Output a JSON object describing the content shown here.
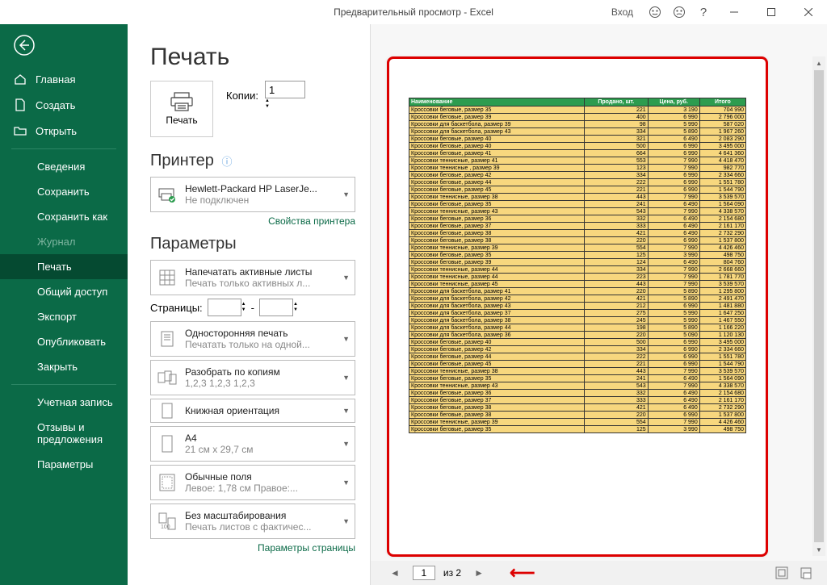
{
  "titlebar": {
    "title": "Предварительный просмотр  -  Excel",
    "login": "Вход"
  },
  "sidebar": {
    "home": "Главная",
    "new": "Создать",
    "open": "Открыть",
    "info": "Сведения",
    "save": "Сохранить",
    "saveas": "Сохранить как",
    "history": "Журнал",
    "print": "Печать",
    "share": "Общий доступ",
    "export": "Экспорт",
    "publish": "Опубликовать",
    "close": "Закрыть",
    "account": "Учетная запись",
    "feedback": "Отзывы и предложения",
    "options": "Параметры"
  },
  "print": {
    "heading": "Печать",
    "button": "Печать",
    "copies_label": "Копии:",
    "copies_value": "1",
    "printer_heading": "Принтер",
    "printer_name": "Hewlett-Packard HP LaserJe...",
    "printer_status": "Не подключен",
    "printer_props": "Свойства принтера",
    "params_heading": "Параметры",
    "active_sheets": "Напечатать активные листы",
    "active_sheets_sub": "Печать только активных л...",
    "pages_label": "Страницы:",
    "pages_sep": "-",
    "oneside": "Односторонняя печать",
    "oneside_sub": "Печатать только на одной...",
    "collate": "Разобрать по копиям",
    "collate_sub": "1,2,3    1,2,3    1,2,3",
    "orientation": "Книжная ориентация",
    "paper": "A4",
    "paper_sub": "21 см x 29,7 см",
    "margins": "Обычные поля",
    "margins_sub": "Левое: 1,78 см   Правое:...",
    "scaling": "Без масштабирования",
    "scaling_sub": "Печать листов с фактичес...",
    "page_setup": "Параметры страницы"
  },
  "status": {
    "page": "1",
    "of": "из 2"
  },
  "chart_data": {
    "type": "table",
    "headers": [
      "Наименование",
      "Продано, шт.",
      "Цена, руб.",
      "Итого"
    ],
    "rows": [
      [
        "Кроссовки беговые, размер 35",
        "221",
        "3 190",
        "704 990"
      ],
      [
        "Кроссовки беговые, размер 39",
        "400",
        "6 990",
        "2 796 000"
      ],
      [
        "Кроссовки для баскетбола, размер 39",
        "98",
        "5 990",
        "587 020"
      ],
      [
        "Кроссовки для баскетбола, размер 43",
        "334",
        "5 890",
        "1 967 260"
      ],
      [
        "Кроссовки беговые, размер 40",
        "321",
        "6 490",
        "2 083 290"
      ],
      [
        "Кроссовки беговые, размер 40",
        "500",
        "6 990",
        "3 495 000"
      ],
      [
        "Кроссовки беговые, размер 41",
        "664",
        "6 990",
        "4 641 360"
      ],
      [
        "Кроссовки теннисные, размер 41",
        "553",
        "7 990",
        "4 418 470"
      ],
      [
        "Кроссовки теннисные , размер 39",
        "123",
        "7 990",
        "982 770"
      ],
      [
        "Кроссовки беговые, размер 42",
        "334",
        "6 990",
        "2 334 660"
      ],
      [
        "Кроссовки беговые, размер 44",
        "222",
        "6 990",
        "1 551 780"
      ],
      [
        "Кроссовки беговые, размер 45",
        "221",
        "6 990",
        "1 544 790"
      ],
      [
        "Кроссовки теннисные, размер 38",
        "443",
        "7 990",
        "3 539 570"
      ],
      [
        "Кроссовки беговые, размер 35",
        "241",
        "6 490",
        "1 564 090"
      ],
      [
        "Кроссовки теннисные, размер 43",
        "543",
        "7 990",
        "4 338 570"
      ],
      [
        "Кроссовки беговые, размер 36",
        "332",
        "6 490",
        "2 154 680"
      ],
      [
        "Кроссовки беговые, размер 37",
        "333",
        "6 490",
        "2 161 170"
      ],
      [
        "Кроссовки беговые, размер 38",
        "421",
        "6 490",
        "2 732 290"
      ],
      [
        "Кроссовки беговые, размер 38",
        "220",
        "6 990",
        "1 537 800"
      ],
      [
        "Кроссовки теннисные, размер 39",
        "554",
        "7 990",
        "4 426 460"
      ],
      [
        "Кроссовки беговые, размер 35",
        "125",
        "3 990",
        "498 750"
      ],
      [
        "Кроссовки беговые, размер 39",
        "124",
        "6 490",
        "804 760"
      ],
      [
        "Кроссовки теннисные, размер 44",
        "334",
        "7 990",
        "2 668 660"
      ],
      [
        "Кроссовки теннисные, размер 44",
        "223",
        "7 990",
        "1 781 770"
      ],
      [
        "Кроссовки теннисные, размер 45",
        "443",
        "7 990",
        "3 539 570"
      ],
      [
        "Кроссовки для баскетбола, размер 41",
        "220",
        "5 890",
        "1 295 800"
      ],
      [
        "Кроссовки для баскетбола, размер 42",
        "421",
        "5 890",
        "2 491 470"
      ],
      [
        "Кроссовки для баскетбола, размер 43",
        "212",
        "6 990",
        "1 481 880"
      ],
      [
        "Кроссовки для баскетбола, размер 37",
        "275",
        "5 990",
        "1 647 250"
      ],
      [
        "Кроссовки для баскетбола, размер 38",
        "245",
        "5 990",
        "1 467 550"
      ],
      [
        "Кроссовки для баскетбола, размер 44",
        "198",
        "5 890",
        "1 166 220"
      ],
      [
        "Кроссовки для баскетбола, размер 36",
        "220",
        "5 090",
        "1 120 130"
      ],
      [
        "Кроссовки беговые, размер 40",
        "500",
        "6 990",
        "3 495 000"
      ],
      [
        "Кроссовки беговые, размер 42",
        "334",
        "6 990",
        "2 334 660"
      ],
      [
        "Кроссовки беговые, размер 44",
        "222",
        "6 990",
        "1 551 780"
      ],
      [
        "Кроссовки беговые, размер 45",
        "221",
        "6 990",
        "1 544 790"
      ],
      [
        "Кроссовки теннисные, размер 38",
        "443",
        "7 990",
        "3 539 570"
      ],
      [
        "Кроссовки беговые, размер 35",
        "241",
        "6 490",
        "1 564 090"
      ],
      [
        "Кроссовки теннисные, размер 43",
        "543",
        "7 990",
        "4 338 570"
      ],
      [
        "Кроссовки беговые, размер 36",
        "332",
        "6 490",
        "2 154 680"
      ],
      [
        "Кроссовки беговые, размер 37",
        "333",
        "6 490",
        "2 161 170"
      ],
      [
        "Кроссовки беговые, размер 38",
        "421",
        "6 490",
        "2 732 290"
      ],
      [
        "Кроссовки беговые, размер 38",
        "220",
        "6 990",
        "1 537 800"
      ],
      [
        "Кроссовки теннисные, размер 39",
        "554",
        "7 990",
        "4 426 460"
      ],
      [
        "Кроссовки беговые, размер 35",
        "125",
        "3 990",
        "498 750"
      ]
    ]
  }
}
